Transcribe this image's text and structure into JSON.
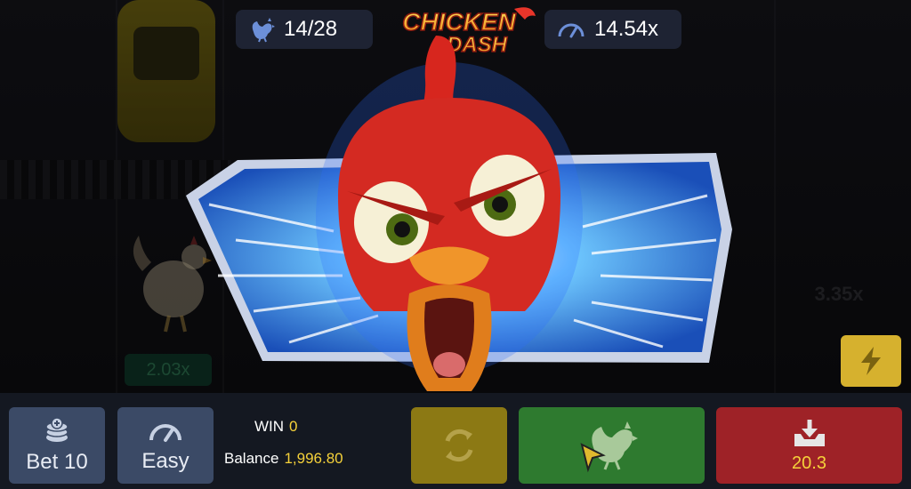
{
  "game": {
    "logo_line1": "CHICKEN",
    "logo_line2": "DASH"
  },
  "top_bar": {
    "progress": "14/28",
    "progress_icon": "rooster-icon",
    "multiplier": "14.54x",
    "multiplier_icon": "speedometer-icon"
  },
  "background": {
    "lane_multiplier_left": "2.03x",
    "lane_multiplier_right": "3.35x"
  },
  "controls": {
    "bet_label": "Bet 10",
    "bet_icon": "coin-stack-icon",
    "difficulty_label": "Easy",
    "difficulty_icon": "speedometer-icon",
    "win_label": "WIN",
    "win_value": "0",
    "balance_label": "Balance",
    "balance_value": "1,996.80",
    "autoplay_icon": "refresh-icon",
    "go_icon": "rooster-icon",
    "cashout_icon": "download-tray-icon",
    "cashout_value": "20.3",
    "turbo_icon": "lightning-icon"
  },
  "colors": {
    "accent_yellow": "#f5d13a",
    "go_green": "#2e7a2f",
    "cashout_red": "#9e2227",
    "panel_blue": "#3b4a66"
  }
}
